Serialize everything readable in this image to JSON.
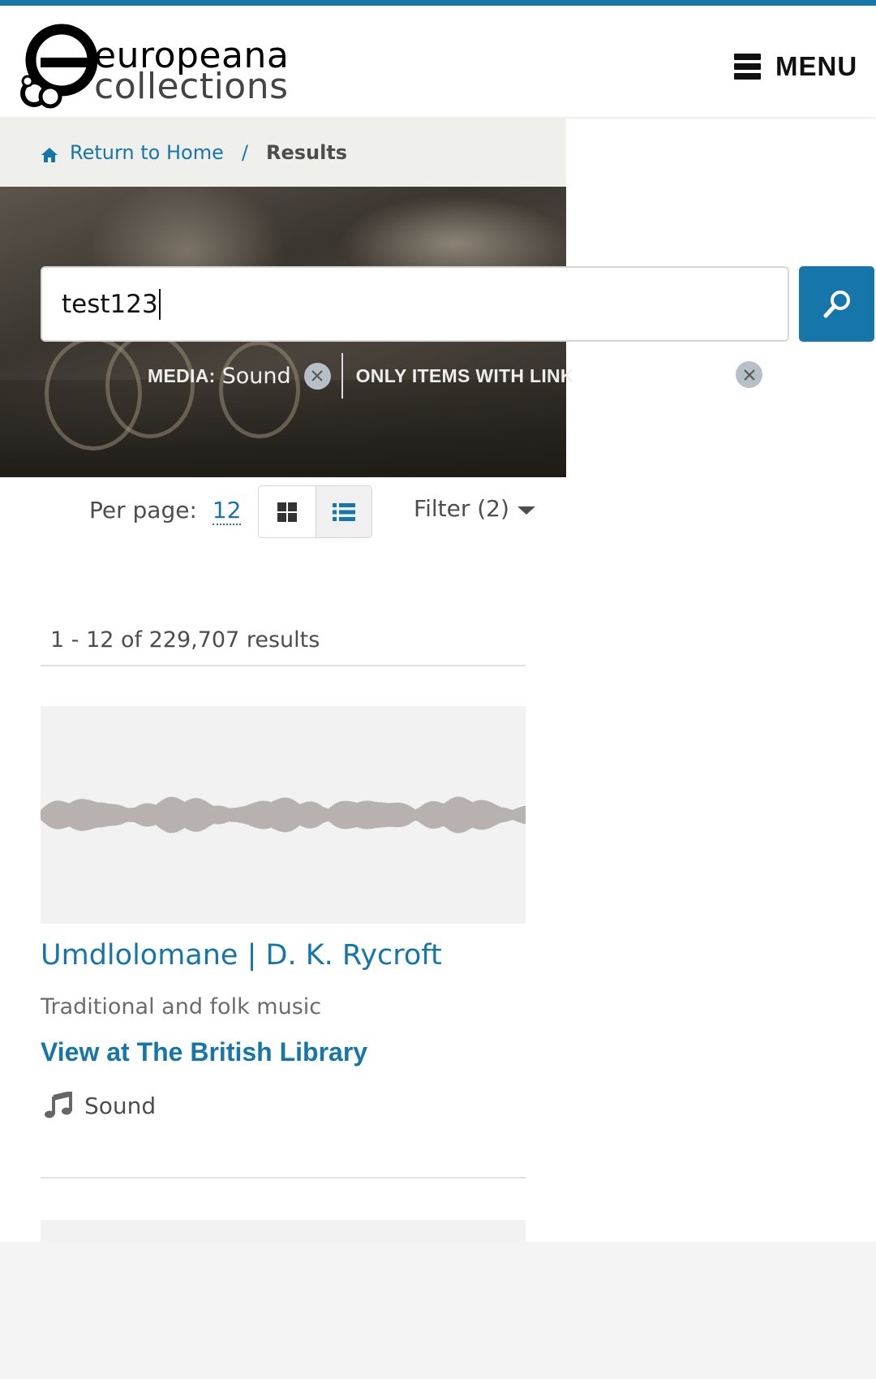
{
  "header": {
    "logo_line1": "europeana",
    "logo_line2": "collections",
    "menu_label": "MENU"
  },
  "breadcrumb": {
    "home_label": "Return to Home",
    "separator": "/",
    "current": "Results"
  },
  "search": {
    "query": "test123"
  },
  "filters": [
    {
      "label": "MEDIA:",
      "value": "Sound"
    },
    {
      "label": "ONLY ITEMS WITH LINK",
      "value": ""
    }
  ],
  "toolbar": {
    "per_page_label": "Per page:",
    "per_page_value": "12",
    "filter_label": "Filter (2)"
  },
  "results": {
    "count_text": "1 - 12 of 229,707 results",
    "items": [
      {
        "title": "Umdlolomane | D. K. Rycroft",
        "description": "Traditional and folk music",
        "provider_link": "View at The British Library",
        "type": "Sound"
      }
    ]
  },
  "icons": {
    "home": "home-icon",
    "search": "search-icon",
    "grid": "grid-view-icon",
    "list": "list-view-icon",
    "music": "music-note-icon",
    "close": "close-icon"
  },
  "colors": {
    "accent": "#1676aa",
    "waveform": "#a8a19f"
  }
}
